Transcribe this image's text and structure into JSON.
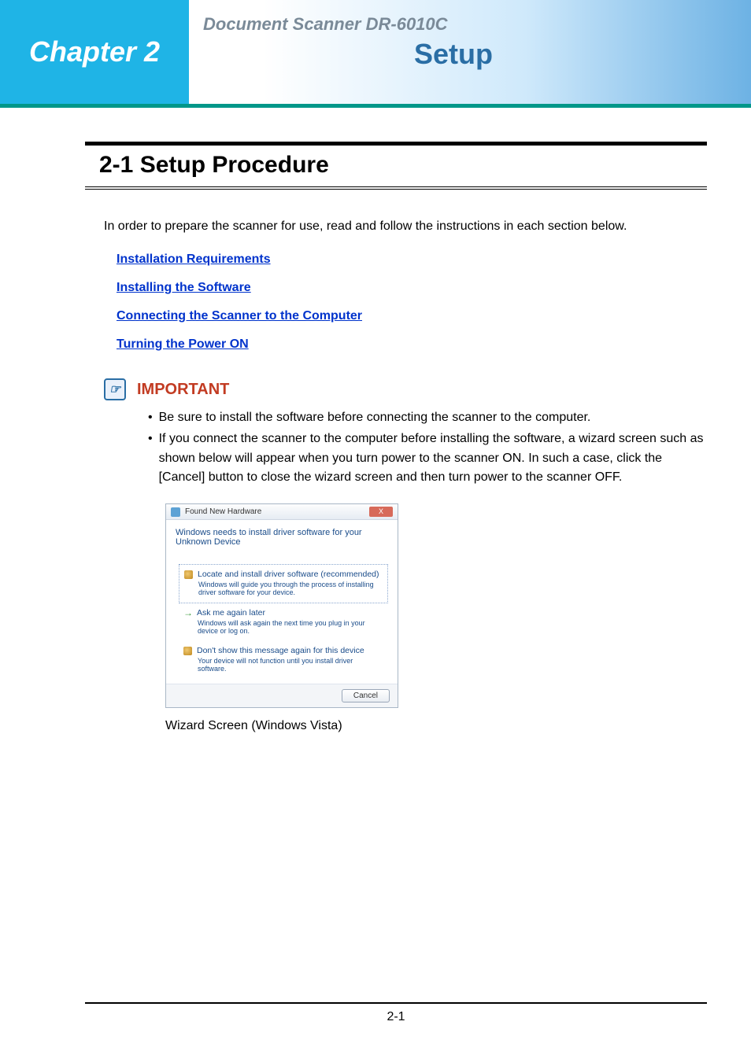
{
  "header": {
    "chapter_label": "Chapter 2",
    "doc_title": "Document Scanner DR-6010C",
    "chapter_title": "Setup"
  },
  "section": {
    "heading": "2-1  Setup Procedure",
    "intro": "In order to prepare the scanner for use, read and follow the instructions in each section below."
  },
  "links": [
    "Installation Requirements",
    "Installing the Software",
    "Connecting the Scanner to the Computer",
    "Turning the Power ON"
  ],
  "important": {
    "label": "IMPORTANT",
    "bullets": [
      "Be sure to install the software before connecting the scanner to the computer.",
      "If you connect the scanner to the computer before installing the software, a wizard screen such as shown below will appear when you turn power to the scanner ON. In such a case, click the [Cancel] button to close the wizard screen and then turn power to the scanner OFF."
    ]
  },
  "wizard": {
    "title": "Found New Hardware",
    "close": "X",
    "message": "Windows needs to install driver software for your Unknown Device",
    "options": [
      {
        "title": "Locate and install driver software (recommended)",
        "desc": "Windows will guide you through the process of installing driver software for your device.",
        "icon": "shield"
      },
      {
        "title": "Ask me again later",
        "desc": "Windows will ask again the next time you plug in your device or log on.",
        "icon": "arrow"
      },
      {
        "title": "Don't show this message again for this device",
        "desc": "Your device will not function until you install driver software.",
        "icon": "shield"
      }
    ],
    "cancel": "Cancel",
    "caption": "Wizard Screen (Windows Vista)"
  },
  "footer": {
    "page": "2-1"
  }
}
